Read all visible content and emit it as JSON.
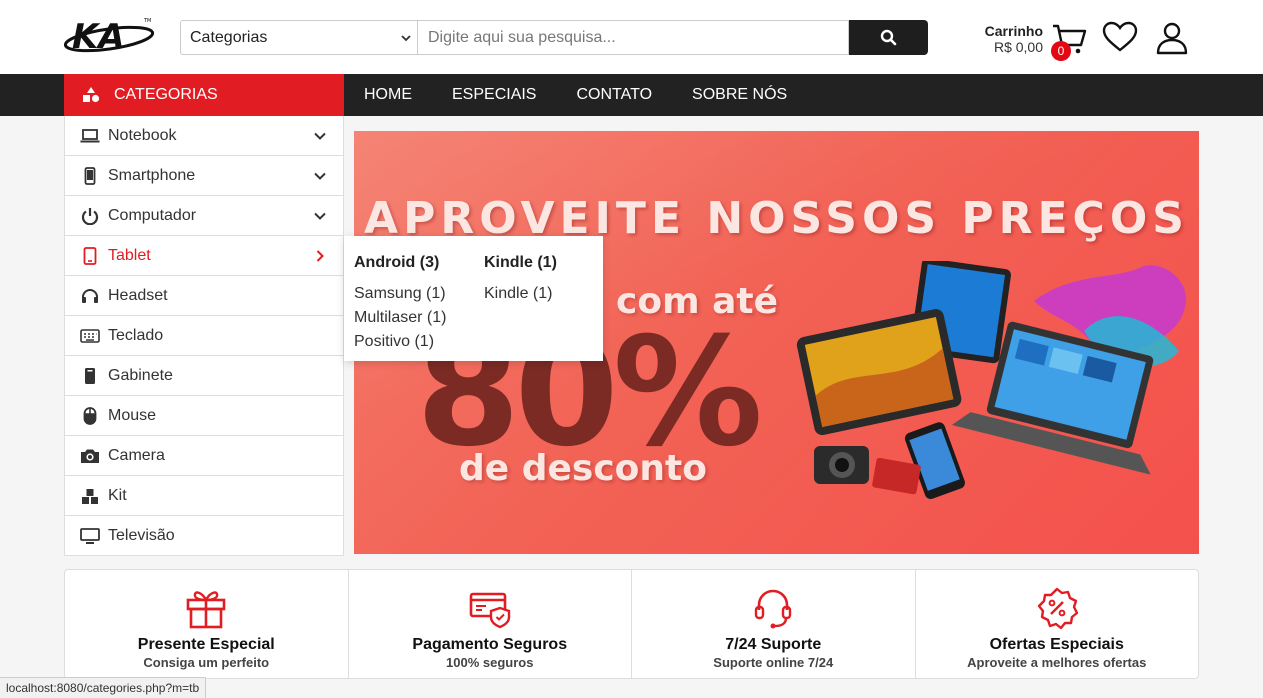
{
  "header": {
    "logo_text": "KA",
    "category_select": "Categorias",
    "search_placeholder": "Digite aqui sua pesquisa...",
    "cart_label": "Carrinho",
    "cart_total": "R$ 0,00",
    "cart_count": "0"
  },
  "nav": {
    "categories_label": "CATEGORIAS",
    "links": [
      "HOME",
      "ESPECIAIS",
      "CONTATO",
      "SOBRE NÓS"
    ]
  },
  "sidebar": {
    "items": [
      {
        "label": "Notebook",
        "icon": "laptop-icon"
      },
      {
        "label": "Smartphone",
        "icon": "smartphone-icon"
      },
      {
        "label": "Computador",
        "icon": "power-icon"
      },
      {
        "label": "Tablet",
        "icon": "tablet-icon"
      },
      {
        "label": "Headset",
        "icon": "headphones-icon"
      },
      {
        "label": "Teclado",
        "icon": "keyboard-icon"
      },
      {
        "label": "Gabinete",
        "icon": "tower-icon"
      },
      {
        "label": "Mouse",
        "icon": "mouse-icon"
      },
      {
        "label": "Camera",
        "icon": "camera-icon"
      },
      {
        "label": "Kit",
        "icon": "boxes-icon"
      },
      {
        "label": "Televisão",
        "icon": "tv-icon"
      }
    ]
  },
  "dropdown": {
    "columns": [
      {
        "title": "Android (3)",
        "items": [
          "Samsung (1)",
          "Multilaser (1)",
          "Positivo (1)"
        ]
      },
      {
        "title": "Kindle (1)",
        "items": [
          "Kindle (1)"
        ]
      }
    ]
  },
  "banner": {
    "title": "APROVEITE NOSSOS PREÇOS",
    "subtitle": "com até",
    "percent": "80%",
    "desc": "de desconto"
  },
  "features": [
    {
      "title": "Presente Especial",
      "sub": "Consiga um perfeito",
      "icon": "gift-icon"
    },
    {
      "title": "Pagamento Seguros",
      "sub": "100% seguros",
      "icon": "secure-card-icon"
    },
    {
      "title": "7/24 Suporte",
      "sub": "Suporte online 7/24",
      "icon": "headset-support-icon"
    },
    {
      "title": "Ofertas Especiais",
      "sub": "Aproveite a melhores ofertas",
      "icon": "discount-badge-icon"
    }
  ],
  "colors": {
    "accent": "#e11d23",
    "nav_bg": "#222222"
  },
  "status_url": "localhost:8080/categories.php?m=tb"
}
